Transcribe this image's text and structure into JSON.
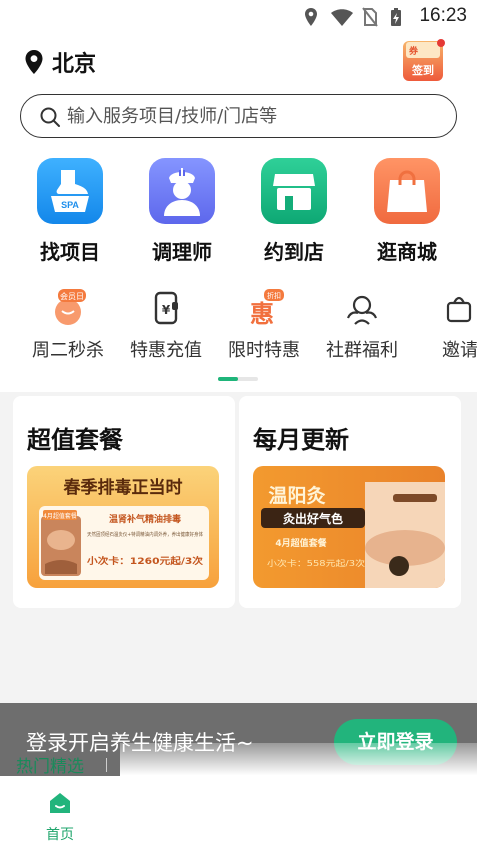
{
  "status_bar": {
    "time": "16:23",
    "icons": [
      "location-icon",
      "wifi-icon",
      "no-sim-icon",
      "battery-charging-icon"
    ]
  },
  "header": {
    "city": "北京",
    "checkin": {
      "ticket": "券",
      "label": "签到"
    }
  },
  "search": {
    "placeholder": "输入服务项目/技师/门店等"
  },
  "main_categories": [
    {
      "label": "找项目",
      "icon": "spa-icon",
      "color": "#1e9bf0"
    },
    {
      "label": "调理师",
      "icon": "therapist-icon",
      "color": "#6f7cf4"
    },
    {
      "label": "约到店",
      "icon": "store-icon",
      "color": "#15b983"
    },
    {
      "label": "逛商城",
      "icon": "shopping-bag-icon",
      "color": "#f7764c"
    }
  ],
  "sub_categories": [
    {
      "label": "周二秒杀",
      "icon": "member-day-icon",
      "badge": "会员日"
    },
    {
      "label": "特惠充值",
      "icon": "recharge-card-icon"
    },
    {
      "label": "限时特惠",
      "icon": "discount-icon",
      "glyph": "惠",
      "badge": "折扣"
    },
    {
      "label": "社群福利",
      "icon": "community-icon"
    },
    {
      "label": "邀请",
      "icon": "invite-icon"
    }
  ],
  "promo_cards": [
    {
      "title": "超值套餐",
      "banner": {
        "headline": "春季排毒正当时",
        "tag": "4月超值套餐",
        "subtitle": "温肾补气精油排毒",
        "desc": "天然固顶经石温灸仪+特调精油内调外养，养出健康好身体",
        "price": "小次卡：1260元起/3次"
      }
    },
    {
      "title": "每月更新",
      "banner": {
        "headline": "温阳灸",
        "sub": "灸出好气色",
        "tag": "4月超值套餐",
        "price": "小次卡：558元起/3次"
      }
    }
  ],
  "login_bar": {
    "text": "登录开启养生健康生活~",
    "button": "立即登录"
  },
  "section": {
    "hot": "热门精选"
  },
  "bottom_nav": {
    "home": "首页"
  }
}
